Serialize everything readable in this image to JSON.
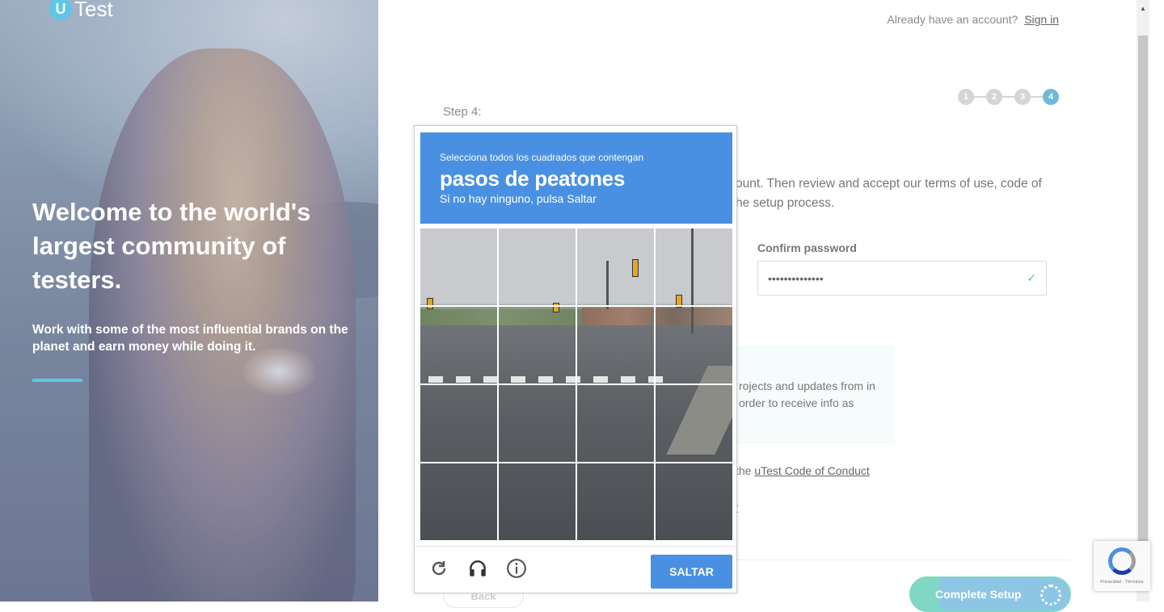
{
  "brand": {
    "logo_letter": "U",
    "logo_text": "Test"
  },
  "hero": {
    "title": "Welcome to the world's largest community of testers.",
    "subtitle": "Work with some of the most influential brands on the planet and earn money while doing it."
  },
  "topbar": {
    "prompt": "Already have an account?",
    "sign_in": "Sign in"
  },
  "steps": {
    "items": [
      "1",
      "2",
      "3",
      "4"
    ],
    "current": 4,
    "label": "Step 4:"
  },
  "form": {
    "intro": "ount. Then review and accept our terms of use, code of he setup process.",
    "confirm_password_label": "Confirm password",
    "confirm_password_value": "••••••••••••••",
    "info_text": "rojects and updates from in order to receive info as",
    "coc_prefix": "the ",
    "coc_link": "uTest Code of Conduct",
    "stray_text": "y",
    "back_label": "Back",
    "complete_label": "Complete Setup"
  },
  "captcha": {
    "instruction": "Selecciona todos los cuadrados que contengan",
    "target": "pasos de peatones",
    "hint": "Si no hay ninguno, pulsa Saltar",
    "skip_label": "SALTAR",
    "icons": [
      "reload-icon",
      "audio-icon",
      "info-icon"
    ],
    "grid_size": 4
  },
  "recaptcha_badge": {
    "text": "Privacidad - Términos"
  },
  "colors": {
    "accent": "#5ec6e8",
    "captcha_blue": "#4a90e2",
    "step_active": "#6fb9d9",
    "success_green": "#5fc79b"
  }
}
